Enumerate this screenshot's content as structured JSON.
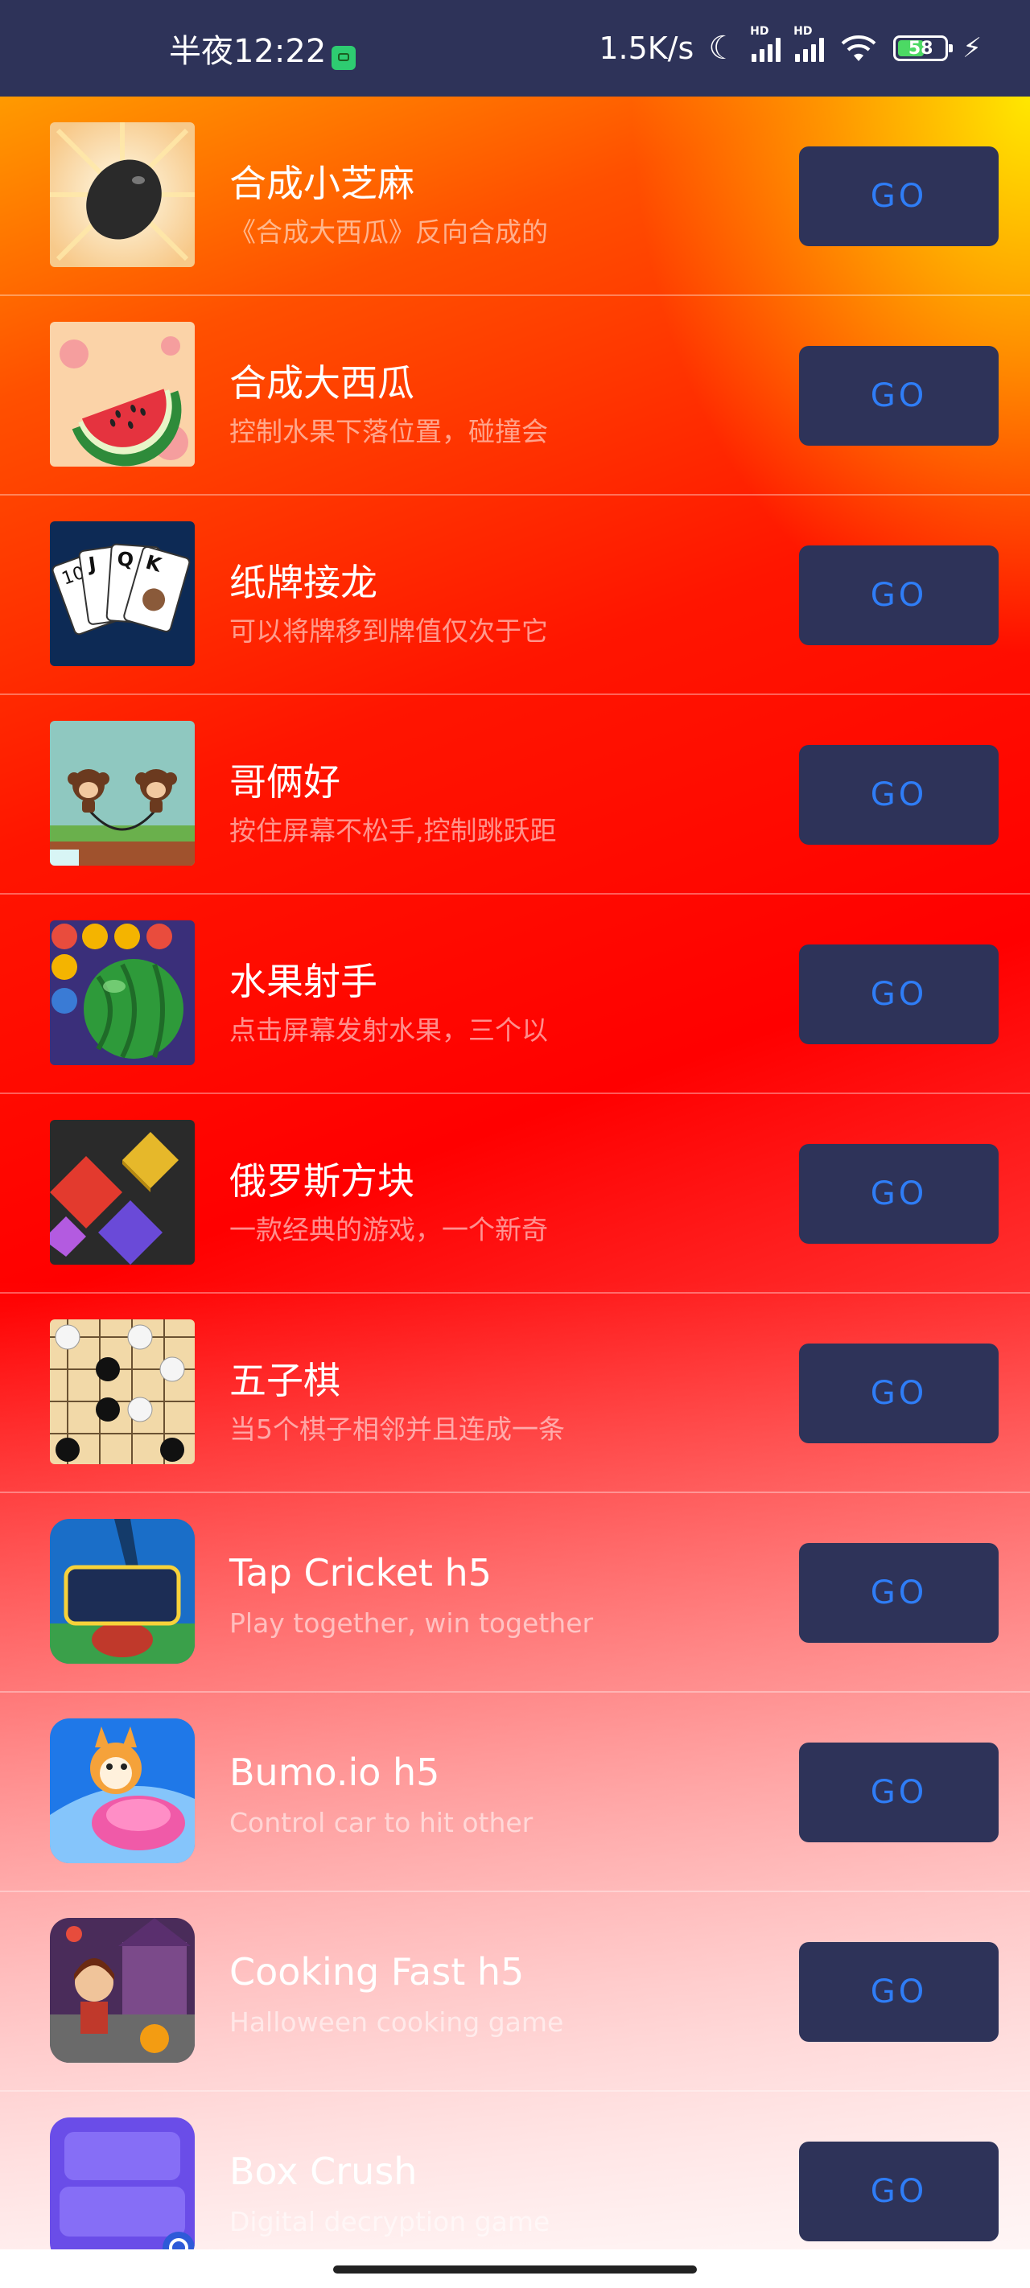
{
  "status_bar": {
    "time": "半夜12:22",
    "net_speed": "1.5K/s",
    "signal_label": "HD",
    "battery": "58"
  },
  "games": [
    {
      "title": "合成小芝麻",
      "desc": "《合成大西瓜》反向合成的",
      "button": "GO",
      "icon": "sesame-icon"
    },
    {
      "title": "合成大西瓜",
      "desc": "控制水果下落位置，碰撞会",
      "button": "GO",
      "icon": "watermelon-icon"
    },
    {
      "title": "纸牌接龙",
      "desc": "可以将牌移到牌值仅次于它",
      "button": "GO",
      "icon": "cards-icon"
    },
    {
      "title": "哥俩好",
      "desc": "按住屏幕不松手,控制跳跃距",
      "button": "GO",
      "icon": "monkeys-icon"
    },
    {
      "title": "水果射手",
      "desc": "点击屏幕发射水果，三个以",
      "button": "GO",
      "icon": "fruit-shooter-icon"
    },
    {
      "title": "俄罗斯方块",
      "desc": "一款经典的游戏，一个新奇",
      "button": "GO",
      "icon": "tetris-blocks-icon"
    },
    {
      "title": "五子棋",
      "desc": "当5个棋子相邻并且连成一条",
      "button": "GO",
      "icon": "gomoku-board-icon"
    },
    {
      "title": "Tap Cricket  h5",
      "desc": "Play together, win together",
      "button": "GO",
      "icon": "tap-cricket-icon"
    },
    {
      "title": "Bumo.io  h5",
      "desc": "Control car to hit other",
      "button": "GO",
      "icon": "bumo-car-icon"
    },
    {
      "title": "Cooking  Fast  h5",
      "desc": "Halloween cooking game",
      "button": "GO",
      "icon": "cooking-fast-icon"
    },
    {
      "title": "Box Crush",
      "desc": "Digital decryption game",
      "button": "GO",
      "icon": "box-crush-icon"
    }
  ]
}
